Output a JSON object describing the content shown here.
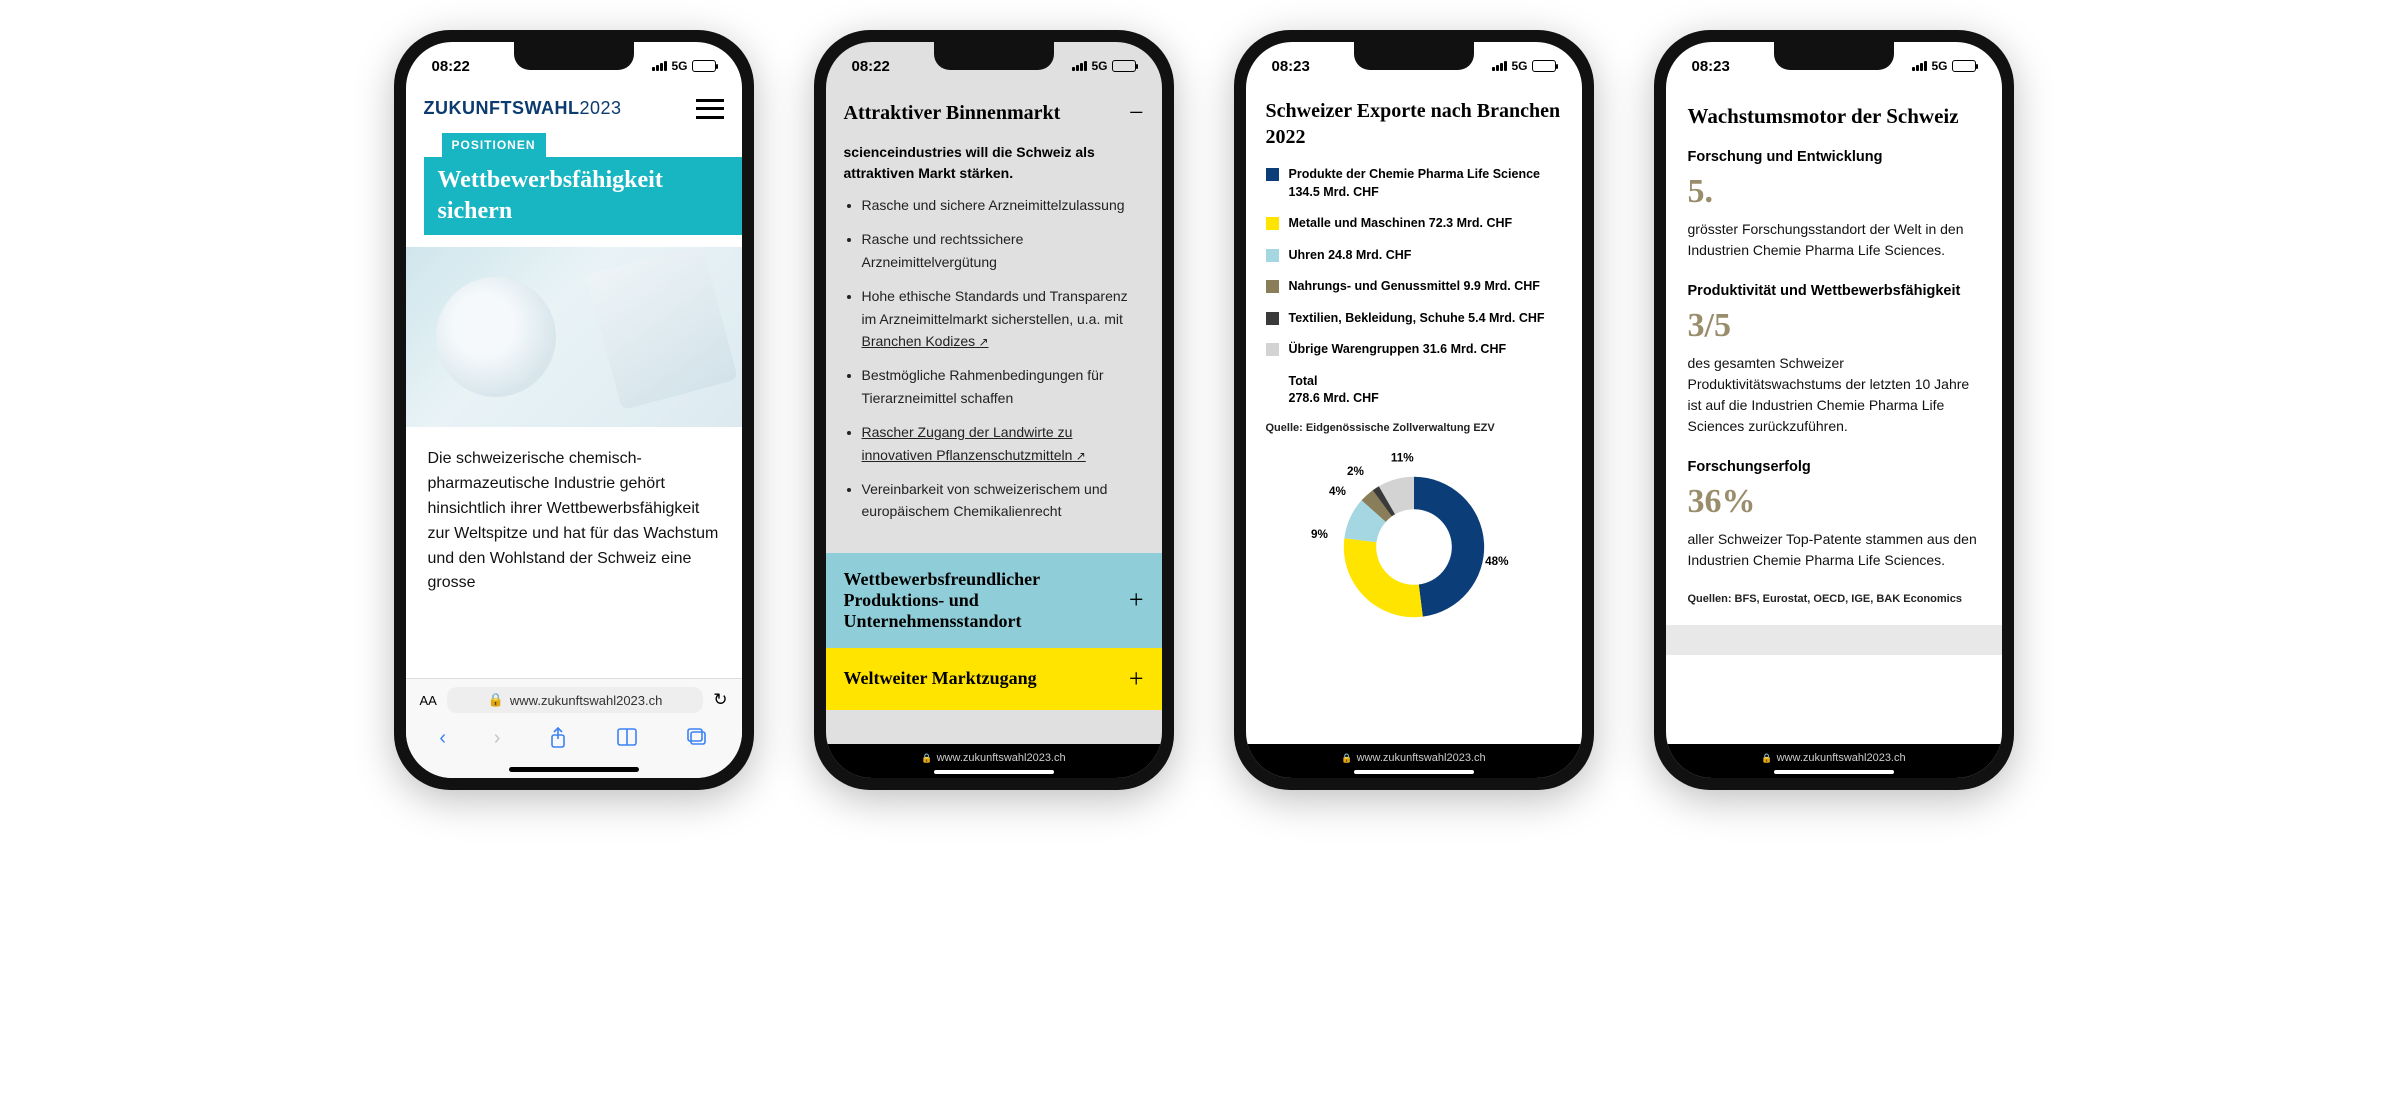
{
  "status": {
    "time_0822": "08:22",
    "time_0823": "08:23",
    "network": "5G"
  },
  "common": {
    "url": "www.zukunftswahl2023.ch",
    "aa": "AA"
  },
  "phone1": {
    "logo_main": "ZUKUNFTSWAHL",
    "logo_year": "2023",
    "tag": "POSITIONEN",
    "headline": "Wettbewerbsfähigkeit sichern",
    "body": "Die schweizerische chemisch-pharmazeutische Industrie gehört hinsichtlich ihrer Wettbewerbsfähigkeit zur Weltspitze und hat für das Wachstum und den Wohlstand der Schweiz eine grosse"
  },
  "phone2": {
    "acc_open_title": "Attraktiver Binnenmarkt",
    "intro": "scienceindustries will die Schweiz als attraktiven Markt stärken.",
    "bullets": [
      "Rasche und sichere Arzneimittelzulassung",
      "Rasche und rechtssichere Arzneimittelvergütung",
      "Hohe ethische Standards und Transparenz im Arzneimittelmarkt sicherstellen, u.a. mit ",
      "Bestmögliche Rahmenbedingungen für Tierarzneimittel schaffen",
      "",
      "Vereinbarkeit von schweizerischem und europäischem Chemikalienrecht"
    ],
    "link1": "Branchen Kodizes",
    "link2": "Rascher Zugang der Landwirte zu innovativen Pflanzenschutzmitteln",
    "acc2": "Wettbewerbsfreundlicher Produktions- und Unternehmensstandort",
    "acc3": "Weltweiter Marktzugang"
  },
  "phone3": {
    "title": "Schweizer Exporte nach Branchen 2022",
    "legend": [
      {
        "color": "#0b3d78",
        "label": "Produkte der Chemie Pharma Life Science 134.5 Mrd. CHF"
      },
      {
        "color": "#ffe400",
        "label": "Metalle und Maschinen 72.3 Mrd. CHF"
      },
      {
        "color": "#a4d7e1",
        "label": "Uhren 24.8 Mrd. CHF"
      },
      {
        "color": "#8a7e5a",
        "label": "Nahrungs- und Genussmittel 9.9 Mrd. CHF"
      },
      {
        "color": "#3a3a3a",
        "label": "Textilien, Bekleidung, Schuhe 5.4 Mrd. CHF"
      },
      {
        "color": "#d3d3d3",
        "label": "Übrige Warengruppen 31.6 Mrd. CHF"
      }
    ],
    "total_label": "Total",
    "total_value": "278.6 Mrd. CHF",
    "source": "Quelle: Eidgenössische Zollverwaltung EZV",
    "slice_labels": {
      "p48": "48%",
      "p11": "11%",
      "p2": "2%",
      "p4": "4%",
      "p9": "9%"
    }
  },
  "phone4": {
    "title": "Wachstumsmotor der Schweiz",
    "stats": [
      {
        "label": "Forschung und Entwicklung",
        "num": "5.",
        "desc": "grösster Forschungsstandort der Welt in den Industrien Chemie Pharma Life Sciences."
      },
      {
        "label": "Produktivität und Wettbewerbsfähigkeit",
        "num": "3/5",
        "desc": "des gesamten Schweizer Produktivitätswachstums der letzten 10 Jahre ist auf die Industrien Chemie Pharma Life Sciences zurückzuführen."
      },
      {
        "label": "Forschungserfolg",
        "num": "36%",
        "desc": "aller Schweizer Top-Patente stammen aus den Industrien Chemie Pharma Life Sciences."
      }
    ],
    "sources": "Quellen: BFS, Eurostat, OECD, IGE, BAK Economics"
  },
  "chart_data": {
    "type": "pie",
    "title": "Schweizer Exporte nach Branchen 2022",
    "categories": [
      "Produkte der Chemie Pharma Life Science",
      "Metalle und Maschinen",
      "Uhren",
      "Nahrungs- und Genussmittel",
      "Textilien, Bekleidung, Schuhe",
      "Übrige Warengruppen"
    ],
    "values_mrd_chf": [
      134.5,
      72.3,
      24.8,
      9.9,
      5.4,
      31.6
    ],
    "percentages": [
      48,
      26,
      9,
      4,
      2,
      11
    ],
    "total_mrd_chf": 278.6,
    "colors": [
      "#0b3d78",
      "#ffe400",
      "#a4d7e1",
      "#8a7e5a",
      "#3a3a3a",
      "#d3d3d3"
    ],
    "source": "Eidgenössische Zollverwaltung EZV"
  }
}
